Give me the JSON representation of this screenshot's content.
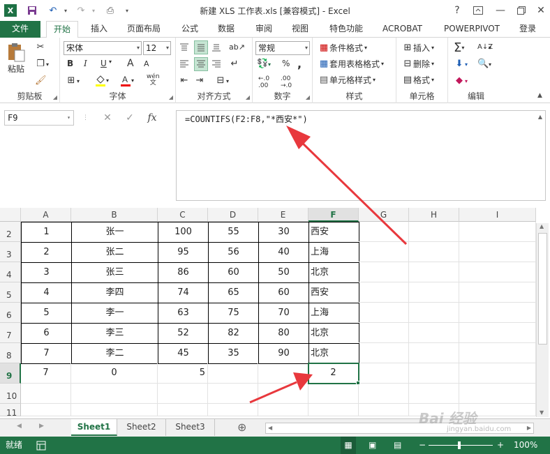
{
  "title_bar": {
    "app_logo": "X",
    "title": "新建 XLS 工作表.xls  [兼容模式] - Excel",
    "help": "?",
    "minimize": "—",
    "close": "✕"
  },
  "ribbon_tabs": [
    "文件",
    "开始",
    "插入",
    "页面布局",
    "公式",
    "数据",
    "审阅",
    "视图",
    "特色功能",
    "ACROBAT",
    "POWERPIVOT",
    "登录"
  ],
  "ribbon": {
    "clipboard": {
      "paste": "粘贴",
      "label": "剪贴板"
    },
    "font": {
      "family": "宋体",
      "size": "12",
      "bold": "B",
      "italic": "I",
      "underline": "U",
      "grow": "A",
      "shrink": "A",
      "label": "字体"
    },
    "alignment": {
      "label": "对齐方式"
    },
    "number": {
      "format": "常规",
      "percent": "%",
      "comma": ",",
      "label": "数字"
    },
    "styles": {
      "conditional": "条件格式",
      "table": "套用表格格式",
      "cell": "单元格样式",
      "label": "样式"
    },
    "cells": {
      "insert": "插入",
      "delete": "删除",
      "format": "格式",
      "label": "单元格"
    },
    "editing": {
      "label": "编辑"
    }
  },
  "formula_bar": {
    "name_box": "F9",
    "cancel": "✕",
    "enter": "✓",
    "fx": "fx",
    "formula": "=COUNTIFS(F2:F8,\"*西安*\")"
  },
  "columns": [
    "A",
    "B",
    "C",
    "D",
    "E",
    "F",
    "G",
    "H",
    "I"
  ],
  "rows": [
    {
      "n": "2",
      "cells": [
        "1",
        "张一",
        "100",
        "55",
        "30",
        "西安"
      ]
    },
    {
      "n": "3",
      "cells": [
        "2",
        "张二",
        "95",
        "56",
        "40",
        "上海"
      ]
    },
    {
      "n": "4",
      "cells": [
        "3",
        "张三",
        "86",
        "60",
        "50",
        "北京"
      ]
    },
    {
      "n": "5",
      "cells": [
        "4",
        "李四",
        "74",
        "65",
        "60",
        "西安"
      ]
    },
    {
      "n": "6",
      "cells": [
        "5",
        "李一",
        "63",
        "75",
        "70",
        "上海"
      ]
    },
    {
      "n": "7",
      "cells": [
        "6",
        "李三",
        "52",
        "82",
        "80",
        "北京"
      ]
    },
    {
      "n": "8",
      "cells": [
        "7",
        "李二",
        "45",
        "35",
        "90",
        "北京"
      ]
    },
    {
      "n": "9",
      "cells": [
        "7",
        "0",
        "5",
        "",
        "",
        "2"
      ]
    },
    {
      "n": "10",
      "cells": [
        "",
        "",
        "",
        "",
        "",
        ""
      ]
    },
    {
      "n": "11",
      "cells": [
        "",
        "",
        "",
        "",
        "",
        ""
      ]
    }
  ],
  "sheets": [
    "Sheet1",
    "Sheet2",
    "Sheet3"
  ],
  "add_sheet": "⊕",
  "status": {
    "ready": "就绪",
    "zoom": "100%",
    "zoom_minus": "−",
    "zoom_plus": "+"
  },
  "watermark": {
    "brand": "Bai 经验",
    "url": "jingyan.baidu.com"
  },
  "colors": {
    "excel_green": "#217346",
    "arrow_red": "#e8383d"
  }
}
